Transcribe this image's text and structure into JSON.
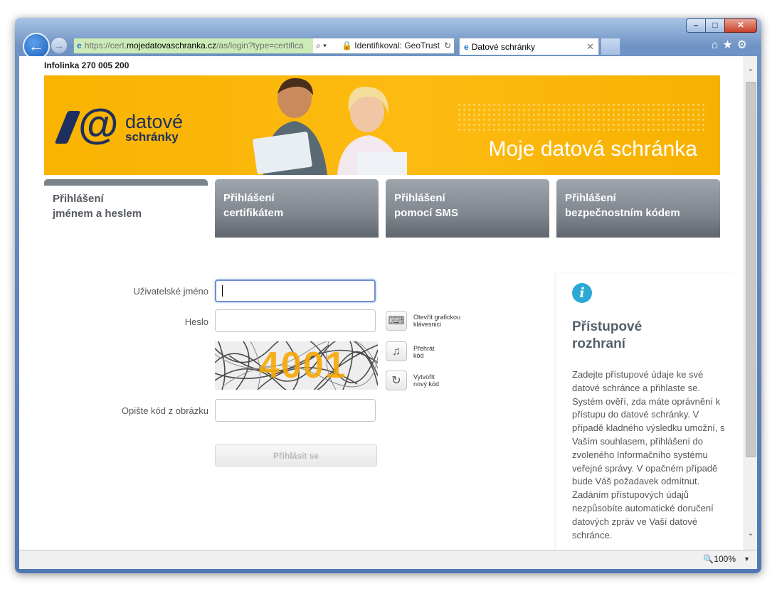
{
  "browser": {
    "url_prefix": "https://cert.",
    "url_domain": "mojedatovaschranka.cz",
    "url_path": "/as/login?type=certifica",
    "identity": "Identifikoval: GeoTrust",
    "tab_title": "Datové schránky",
    "zoom": "100%"
  },
  "page": {
    "infoline": "Infolinka 270 005 200",
    "logo_line1": "datové",
    "logo_line2": "schránky",
    "banner_title": "Moje datová schránka"
  },
  "tabs": [
    {
      "line1": "Přihlášení",
      "line2": "jménem a heslem",
      "active": true
    },
    {
      "line1": "Přihlášení",
      "line2": "certifikátem",
      "active": false
    },
    {
      "line1": "Přihlášení",
      "line2": "pomocí SMS",
      "active": false
    },
    {
      "line1": "Přihlášení",
      "line2": "bezpečnostním kódem",
      "active": false
    }
  ],
  "form": {
    "username_label": "Uživatelské jméno",
    "username_value": "",
    "password_label": "Heslo",
    "password_value": "",
    "keyboard_label_1": "Otevřít grafickou",
    "keyboard_label_2": "klávesnici",
    "play_label_1": "Přehrát",
    "play_label_2": "kód",
    "new_code_label_1": "Vytvořit",
    "new_code_label_2": "nový kód",
    "captcha_text": "4001",
    "captcha_label": "Opište kód z obrázku",
    "captcha_value": "",
    "submit_label": "Přihlásit se"
  },
  "info": {
    "title_line1": "Přístupové",
    "title_line2": "rozhraní",
    "text": "Zadejte přístupové údaje ke své datové schránce a přihlaste se. Systém ověří, zda máte oprávnění k přístupu do datové schránky. V případě kladného výsledku umožní, s Vaším souhlasem, přihlášení do zvoleného Informačního systému veřejné správy. V opačném případě bude Váš požadavek odmítnut. Zadáním přístupových údajů nezpůsobíte automatické doručení datových zpráv ve Vaší datové schránce."
  },
  "colors": {
    "banner": "#fdbb12",
    "tab_gray": "#7f868e",
    "info_icon": "#29a9d4",
    "logo_navy": "#1d2f5e"
  },
  "icons": [
    "back-arrow-icon",
    "forward-arrow-icon",
    "ie-logo-icon",
    "search-icon",
    "lock-icon",
    "refresh-icon",
    "home-icon",
    "star-icon",
    "gear-icon",
    "keyboard-icon",
    "music-note-icon",
    "reload-icon",
    "info-icon",
    "zoom-icon"
  ]
}
